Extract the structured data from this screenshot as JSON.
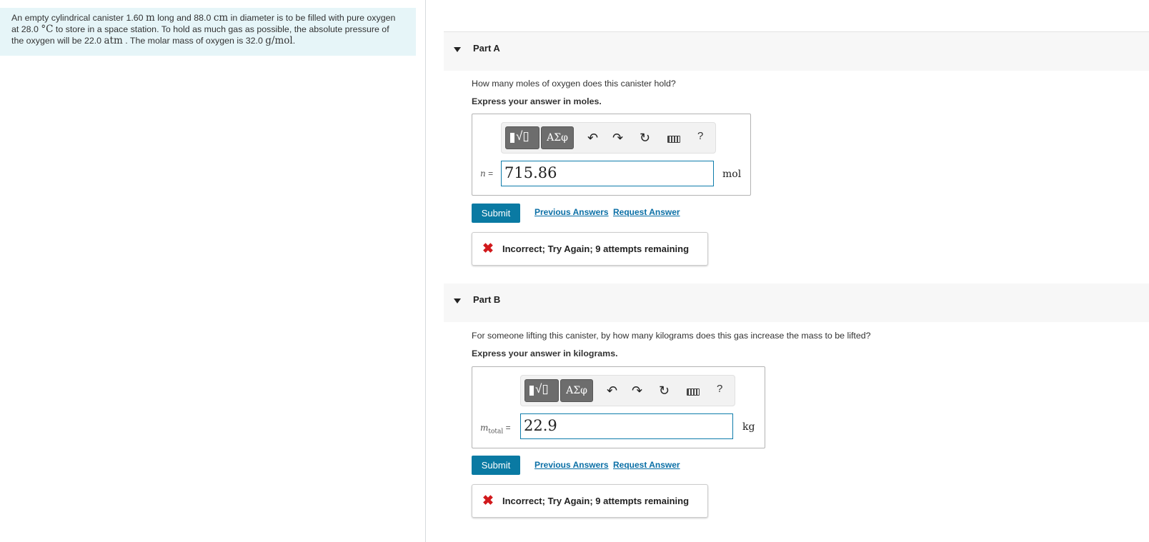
{
  "problem": {
    "t1": "An empty cylindrical canister 1.60 ",
    "u_m": "m",
    "t2": " long and 88.0 ",
    "u_cm": "cm",
    "t3": " in diameter is to be filled with pure oxygen",
    "t4": "at 28.0 ",
    "u_c": "°C",
    "t5": " to store in a space station. To hold as much gas as possible, the absolute pressure of",
    "t6": "the oxygen will be 22.0 ",
    "u_atm": "atm",
    "t7": " . The molar mass of oxygen is 32.0 ",
    "u_gmol": "g/mol",
    "t8": "."
  },
  "toolbar": {
    "greek": "ΑΣφ",
    "radical": "√▯",
    "undo": "↶",
    "redo": "↷",
    "reset": "↻",
    "help": "?"
  },
  "partA": {
    "title": "Part A",
    "question": "How many moles of oxygen does this canister hold?",
    "instruction": "Express your answer in moles.",
    "var": "n",
    "eq": " =",
    "value": "715.86",
    "unit": "mol",
    "submit": "Submit",
    "prev": "Previous Answers",
    "request": "Request Answer",
    "feedback": "Incorrect; Try Again; 9 attempts remaining",
    "x": "✖"
  },
  "partB": {
    "title": "Part B",
    "question": "For someone lifting this canister, by how many kilograms does this gas increase the mass to be lifted?",
    "instruction": "Express your answer in kilograms.",
    "var": "m",
    "sub": "total",
    "eq": " =",
    "value": "22.9",
    "unit": "kg",
    "submit": "Submit",
    "prev": "Previous Answers",
    "request": "Request Answer",
    "feedback": "Incorrect; Try Again; 9 attempts remaining",
    "x": "✖"
  }
}
